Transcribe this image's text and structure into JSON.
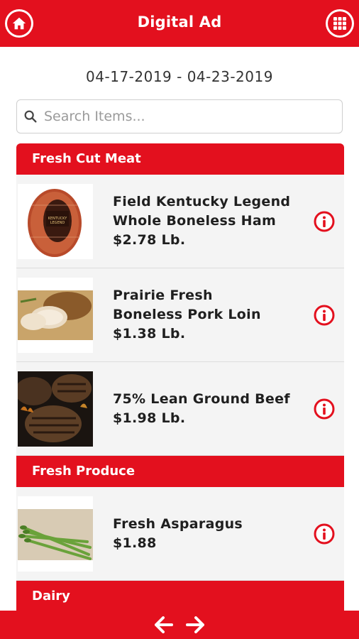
{
  "header": {
    "title": "Digital Ad",
    "home_icon": "home-icon",
    "menu_icon": "grid-menu-icon"
  },
  "date_range": "04-17-2019 - 04-23-2019",
  "search": {
    "placeholder": "Search Items...",
    "value": ""
  },
  "sections": [
    {
      "title": "Fresh Cut Meat",
      "items": [
        {
          "name_line1": "Field Kentucky Legend",
          "name_line2": "Whole Boneless Ham",
          "price": "$2.78 Lb.",
          "image": "ham-image"
        },
        {
          "name_line1": "Prairie Fresh",
          "name_line2": "Boneless Pork Loin",
          "price": "$1.38 Lb.",
          "image": "pork-loin-image"
        },
        {
          "name_line1": "75% Lean Ground Beef",
          "price": "$1.98 Lb.",
          "image": "ground-beef-image"
        }
      ]
    },
    {
      "title": "Fresh Produce",
      "items": [
        {
          "name_line1": "Fresh Asparagus",
          "price": "$1.88",
          "image": "asparagus-image"
        }
      ]
    },
    {
      "title": "Dairy",
      "items": []
    }
  ],
  "footer": {
    "prev_icon": "arrow-left-icon",
    "next_icon": "arrow-right-icon"
  },
  "colors": {
    "brand_red": "#e3101e",
    "list_bg": "#f4f4f4"
  }
}
